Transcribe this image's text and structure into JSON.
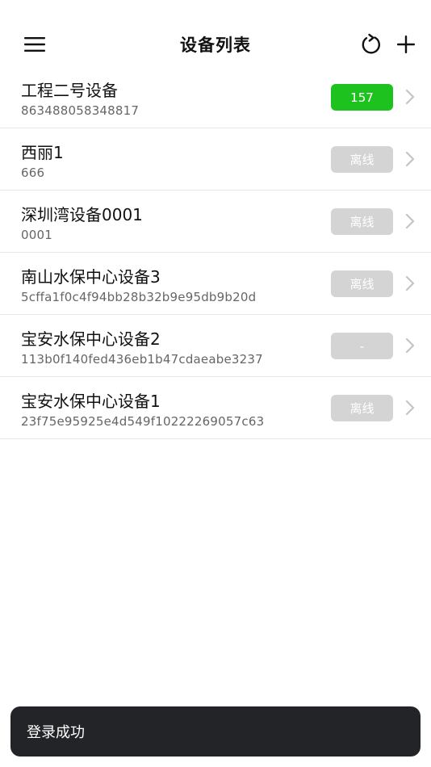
{
  "header": {
    "title": "设备列表"
  },
  "devices": [
    {
      "name": "工程二号设备",
      "id": "863488058348817",
      "status": "157",
      "state": "online"
    },
    {
      "name": "西丽1",
      "id": "666",
      "status": "离线",
      "state": "offline"
    },
    {
      "name": "深圳湾设备0001",
      "id": "0001",
      "status": "离线",
      "state": "offline"
    },
    {
      "name": "南山水保中心设备3",
      "id": "5cffa1f0c4f94bb28b32b9e95db9b20d",
      "status": "离线",
      "state": "offline"
    },
    {
      "name": "宝安水保中心设备2",
      "id": "113b0f140fed436eb1b47cdaeabe3237",
      "status": "-",
      "state": "offline"
    },
    {
      "name": "宝安水保中心设备1",
      "id": "23f75e95925e4d549f10222269057c63",
      "status": "离线",
      "state": "offline"
    }
  ],
  "toast": {
    "message": "登录成功"
  },
  "colors": {
    "online": "#1ec21e",
    "offline": "#d4d4d4",
    "toast_bg": "#232428"
  },
  "icons": {
    "menu": "hamburger-icon",
    "refresh": "refresh-icon",
    "add": "plus-icon",
    "row_arrow": "chevron-right-icon"
  }
}
